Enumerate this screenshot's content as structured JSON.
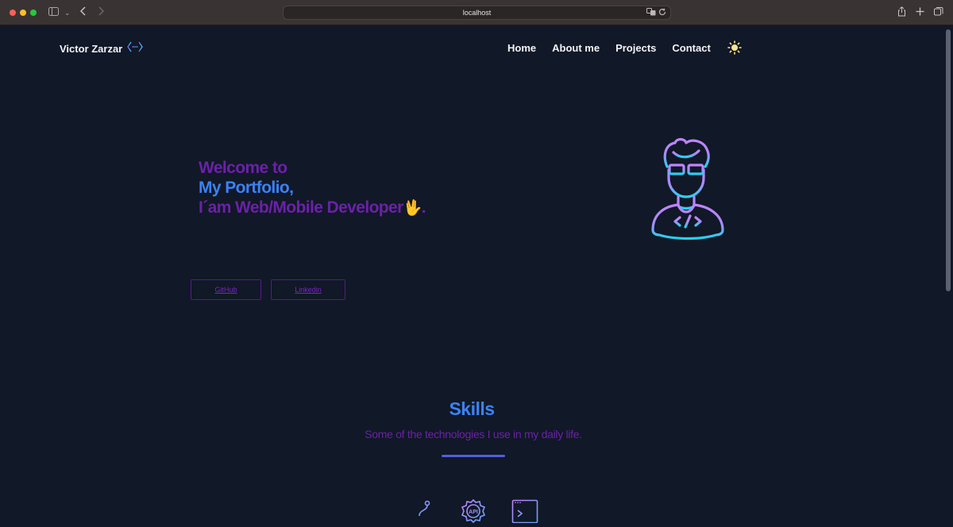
{
  "browser": {
    "url": "localhost"
  },
  "header": {
    "brand": "Victor Zarzar",
    "nav": [
      "Home",
      "About me",
      "Projects",
      "Contact"
    ]
  },
  "hero": {
    "line1": "Welcome to",
    "line2": "My Portfolio,",
    "line3": "I´am Web/Mobile Developer",
    "hand": "🖖",
    "period": "."
  },
  "buttons": {
    "github": "GitHub",
    "linkedin": "Linkedin"
  },
  "skills": {
    "title": "Skills",
    "subtitle": "Some of the technologies I use in my daily life.",
    "icons": [
      "git-branch-icon",
      "api-gear-icon",
      "terminal-icon"
    ],
    "api_label": "API"
  },
  "colors": {
    "background": "#111827",
    "purple": "#6b21a8",
    "blue": "#3b82f6"
  }
}
